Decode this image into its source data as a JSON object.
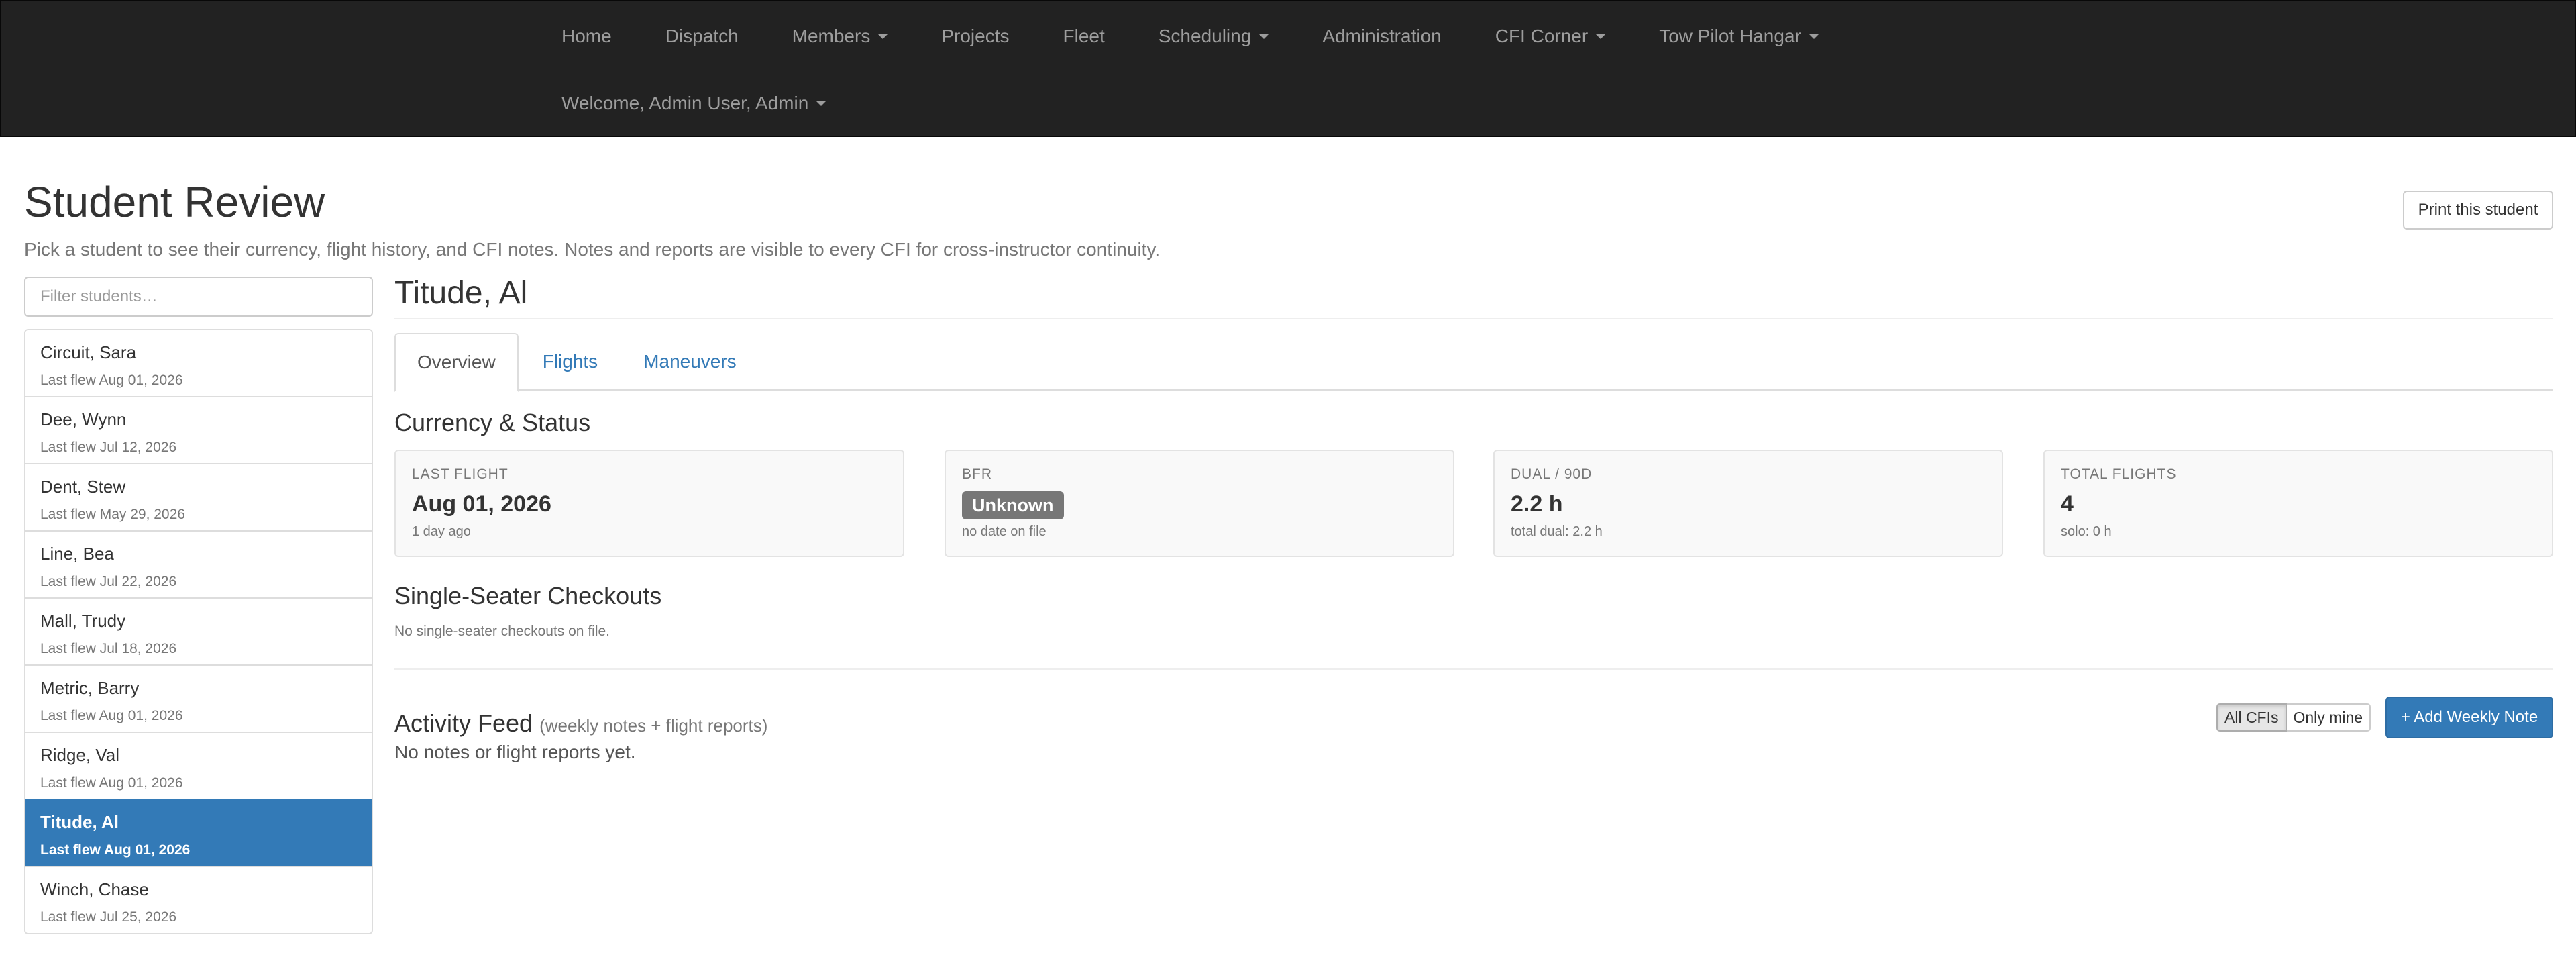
{
  "nav": {
    "items": [
      {
        "label": "Home",
        "dropdown": false
      },
      {
        "label": "Dispatch",
        "dropdown": false
      },
      {
        "label": "Members",
        "dropdown": true
      },
      {
        "label": "Projects",
        "dropdown": false
      },
      {
        "label": "Fleet",
        "dropdown": false
      },
      {
        "label": "Scheduling",
        "dropdown": true
      },
      {
        "label": "Administration",
        "dropdown": false
      },
      {
        "label": "CFI Corner",
        "dropdown": true
      },
      {
        "label": "Tow Pilot Hangar",
        "dropdown": true
      }
    ],
    "welcome": "Welcome, Admin User, Admin"
  },
  "header": {
    "title": "Student Review",
    "subtitle": "Pick a student to see their currency, flight history, and CFI notes. Notes and reports are visible to every CFI for cross-instructor continuity.",
    "print_button": "Print this student"
  },
  "sidebar": {
    "filter_placeholder": "Filter students…",
    "students": [
      {
        "name": "Circuit, Sara",
        "last_flew": "Last flew Aug 01, 2026",
        "active": false
      },
      {
        "name": "Dee, Wynn",
        "last_flew": "Last flew Jul 12, 2026",
        "active": false
      },
      {
        "name": "Dent, Stew",
        "last_flew": "Last flew May 29, 2026",
        "active": false
      },
      {
        "name": "Line, Bea",
        "last_flew": "Last flew Jul 22, 2026",
        "active": false
      },
      {
        "name": "Mall, Trudy",
        "last_flew": "Last flew Jul 18, 2026",
        "active": false
      },
      {
        "name": "Metric, Barry",
        "last_flew": "Last flew Aug 01, 2026",
        "active": false
      },
      {
        "name": "Ridge, Val",
        "last_flew": "Last flew Aug 01, 2026",
        "active": false
      },
      {
        "name": "Titude, Al",
        "last_flew": "Last flew Aug 01, 2026",
        "active": true
      },
      {
        "name": "Winch, Chase",
        "last_flew": "Last flew Jul 25, 2026",
        "active": false
      }
    ]
  },
  "main": {
    "student_name": "Titude, Al",
    "tabs": [
      {
        "label": "Overview",
        "active": true
      },
      {
        "label": "Flights",
        "active": false
      },
      {
        "label": "Maneuvers",
        "active": false
      }
    ],
    "currency_title": "Currency & Status",
    "cards": {
      "last_flight": {
        "label": "LAST FLIGHT",
        "value": "Aug 01, 2026",
        "sub": "1 day ago"
      },
      "bfr": {
        "label": "BFR",
        "badge": "Unknown",
        "sub": "no date on file"
      },
      "dual": {
        "label": "DUAL / 90D",
        "value": "2.2 h",
        "sub": "total dual: 2.2 h"
      },
      "total": {
        "label": "TOTAL FLIGHTS",
        "value": "4",
        "sub": "solo: 0 h"
      }
    },
    "checkouts_title": "Single-Seater Checkouts",
    "checkouts_empty": "No single-seater checkouts on file.",
    "activity_title": "Activity Feed",
    "activity_suffix": "(weekly notes + flight reports)",
    "activity_empty": "No notes or flight reports yet.",
    "filter_all": "All CFIs",
    "filter_mine": "Only mine",
    "add_note": "+ Add Weekly Note"
  },
  "colors": {
    "navbar_bg": "#222222",
    "primary": "#337ab7",
    "badge_gray": "#777777"
  }
}
